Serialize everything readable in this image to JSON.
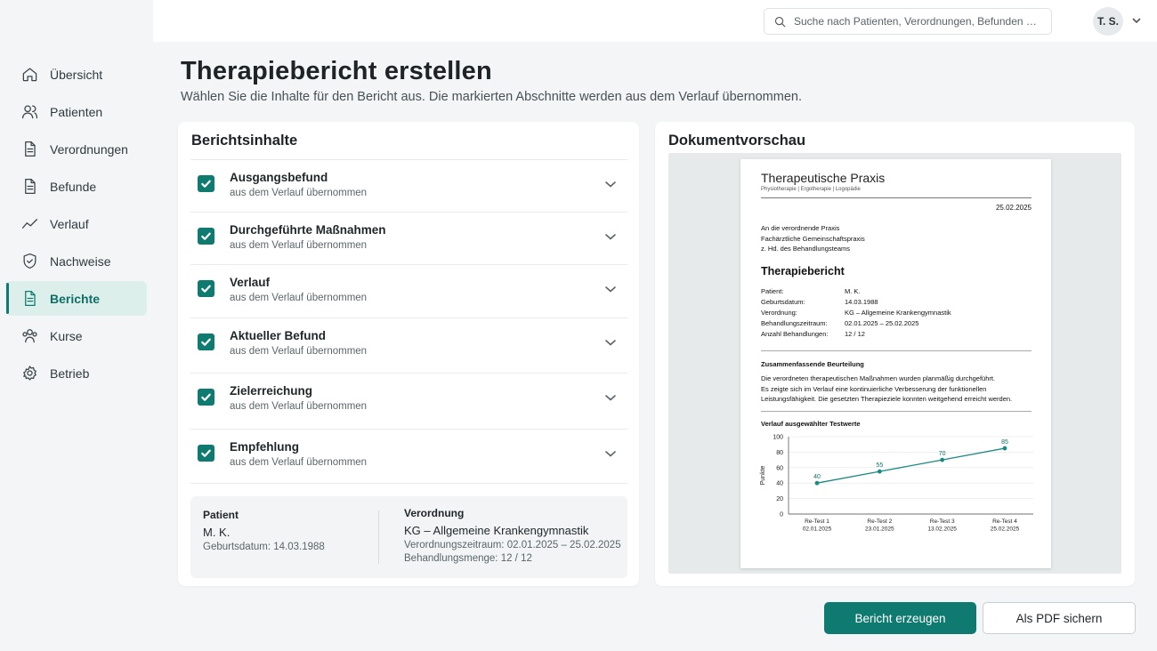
{
  "sidebar": {
    "items": [
      {
        "label": "Übersicht",
        "icon": "home-icon"
      },
      {
        "label": "Patienten",
        "icon": "users-icon"
      },
      {
        "label": "Verordnungen",
        "icon": "document-icon"
      },
      {
        "label": "Befunde",
        "icon": "document-icon"
      },
      {
        "label": "Verlauf",
        "icon": "trend-icon"
      },
      {
        "label": "Nachweise",
        "icon": "shield-icon"
      },
      {
        "label": "Berichte",
        "icon": "report-icon",
        "active": true
      },
      {
        "label": "Kurse",
        "icon": "group-icon"
      },
      {
        "label": "Betrieb",
        "icon": "gear-icon"
      }
    ]
  },
  "topbar": {
    "search_placeholder": "Suche nach Patienten, Verordnungen, Befunden …",
    "user_initials": "T. S."
  },
  "page": {
    "title": "Therapiebericht erstellen",
    "subtitle": "Wählen Sie die Inhalte für den Bericht aus. Die markierten Abschnitte werden aus dem Verlauf übernommen."
  },
  "contents": {
    "title": "Berichtsinhalte",
    "sections": [
      {
        "label": "Ausgangsbefund",
        "sub": "aus dem Verlauf übernommen",
        "checked": true
      },
      {
        "label": "Durchgeführte Maßnahmen",
        "sub": "aus dem Verlauf übernommen",
        "checked": true
      },
      {
        "label": "Verlauf",
        "sub": "aus dem Verlauf übernommen",
        "checked": true
      },
      {
        "label": "Aktueller Befund",
        "sub": "aus dem Verlauf übernommen",
        "checked": true
      },
      {
        "label": "Zielerreichung",
        "sub": "aus dem Verlauf übernommen",
        "checked": true
      },
      {
        "label": "Empfehlung",
        "sub": "aus dem Verlauf übernommen",
        "checked": true
      }
    ],
    "patient": {
      "heading": "Patient",
      "name": "M. K.",
      "birth": "Geburtsdatum: 14.03.1988"
    },
    "prescription": {
      "heading": "Verordnung",
      "type": "KG – Allgemeine Krankengymnastik",
      "period": "Verordnungszeitraum: 02.01.2025 – 25.02.2025",
      "amount": "Behandlungsmenge: 12 / 12"
    }
  },
  "preview": {
    "title": "Dokumentvorschau",
    "doc": {
      "practice": "Therapeutische Praxis",
      "tagline": "Physiotherapie | Ergotherapie | Logopädie",
      "date": "25.02.2025",
      "address": [
        "An die verordnende Praxis",
        "Fachärztliche Gemeinschaftspraxis",
        "z. Hd. des Behandlungsteams"
      ],
      "title": "Therapiebericht",
      "fields": [
        {
          "k": "Patient:",
          "v": "M. K."
        },
        {
          "k": "Geburtsdatum:",
          "v": "14.03.1988"
        },
        {
          "k": "Verordnung:",
          "v": "KG – Allgemeine Krankengymnastik"
        },
        {
          "k": "Behandlungszeitraum:",
          "v": "02.01.2025 – 25.02.2025"
        },
        {
          "k": "Anzahl Behandlungen:",
          "v": "12 / 12"
        }
      ],
      "summary_heading": "Zusammenfassende Beurteilung",
      "summary_lines": [
        "Die verordneten therapeutischen Maßnahmen wurden planmäßig durchgeführt.",
        "Es zeigte sich im Verlauf eine kontinuierliche Verbesserung der funktionellen",
        "Leistungsfähigkeit. Die gesetzten Therapieziele konnten weitgehend erreicht werden."
      ],
      "chart_heading": "Verlauf ausgewählter Testwerte"
    }
  },
  "chart_data": {
    "type": "line",
    "title": "Verlauf ausgewählter Testwerte",
    "ylabel": "Punkte",
    "xlabel": "",
    "ylim": [
      0,
      100
    ],
    "yticks": [
      0,
      20,
      40,
      60,
      80,
      100
    ],
    "grid": true,
    "color": "#1a8a80",
    "categories": [
      {
        "label": "Re-Test 1",
        "date": "02.01.2025"
      },
      {
        "label": "Re-Test 2",
        "date": "23.01.2025"
      },
      {
        "label": "Re-Test 3",
        "date": "13.02.2025"
      },
      {
        "label": "Re-Test 4",
        "date": "25.02.2025"
      }
    ],
    "values": [
      40,
      55,
      70,
      85
    ]
  },
  "actions": {
    "generate": "Bericht erzeugen",
    "save_pdf": "Als PDF sichern"
  },
  "colors": {
    "accent": "#0f7a70",
    "accent_light": "#dcefeb"
  }
}
